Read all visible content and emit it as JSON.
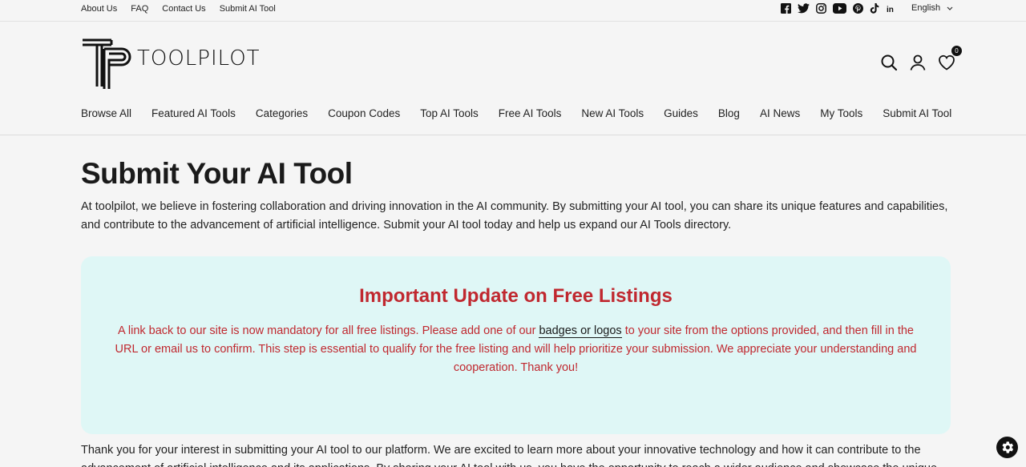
{
  "topbar": {
    "links": [
      "About Us",
      "FAQ",
      "Contact Us",
      "Submit AI Tool"
    ],
    "language": "English"
  },
  "header": {
    "logo_text": "TOOLPILOT",
    "wishlist_count": "0"
  },
  "nav": [
    "Browse All",
    "Featured AI Tools",
    "Categories",
    "Coupon Codes",
    "Top AI Tools",
    "Free AI Tools",
    "New AI Tools",
    "Guides",
    "Blog",
    "AI News",
    "My Tools",
    "Submit AI Tool"
  ],
  "main": {
    "title": "Submit Your AI Tool",
    "intro": "At toolpilot, we believe in fostering collaboration and driving innovation in the AI community. By submitting your AI tool, you can share its unique features and capabilities, and contribute to the advancement of artificial intelligence. Submit your AI tool today and help us expand our AI Tools directory.",
    "update": {
      "title": "Important Update on Free Listings",
      "text_before": "A link back to our site is now mandatory for all free listings. Please add one of our ",
      "link": "badges or logos",
      "text_after": " to your site from the options provided, and then fill in the URL or email us to confirm. This step is essential to qualify for the free listing and will help prioritize your submission. We appreciate your understanding and cooperation. Thank you!"
    },
    "thanks": "Thank you for your interest in submitting your AI tool to our platform. We are excited to learn more about your innovative technology and how it can contribute to the advancement of artificial intelligence and its applications. By sharing your AI tool with us, you have the opportunity to reach a wider audience and showcase the unique"
  },
  "colors": {
    "accent_red": "#c0282f",
    "box_bg": "#dff7f6"
  }
}
